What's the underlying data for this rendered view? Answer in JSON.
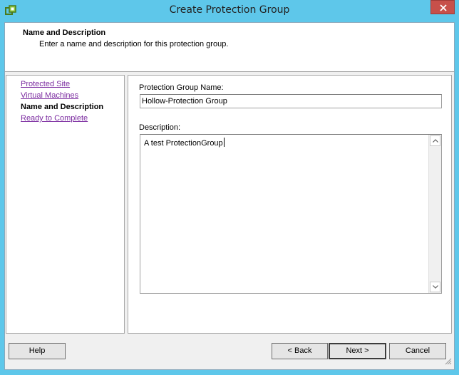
{
  "window": {
    "title": "Create Protection Group"
  },
  "header": {
    "title": "Name and Description",
    "subtitle": "Enter a name and description for this protection group."
  },
  "nav": {
    "items": [
      {
        "label": "Protected Site",
        "state": "visited"
      },
      {
        "label": "Virtual Machines",
        "state": "visited"
      },
      {
        "label": "Name and Description",
        "state": "current"
      },
      {
        "label": "Ready to Complete",
        "state": "link"
      }
    ]
  },
  "form": {
    "name_label": "Protection Group Name:",
    "name_value": "Hollow-Protection Group",
    "description_label": "Description:",
    "description_value": "A test ProtectionGroup"
  },
  "buttons": {
    "help": "Help",
    "back": "< Back",
    "next": "Next >",
    "cancel": "Cancel"
  },
  "colors": {
    "titlebar": "#5ec7ea",
    "close_button": "#c7504a",
    "visited_link": "#7b2ba0"
  },
  "icons": {
    "app": "vmware-app-icon",
    "close": "close-icon",
    "resize": "resize-grip-icon"
  }
}
